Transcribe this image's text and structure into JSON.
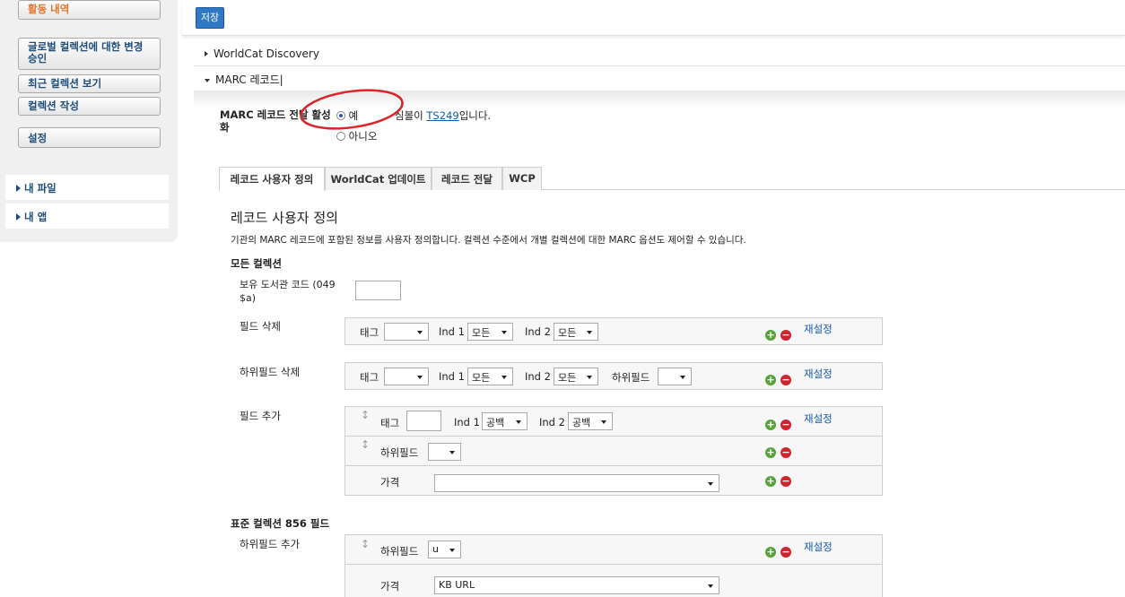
{
  "sidebar": {
    "activity": "활동 내역",
    "global_approve": "글로벌 컬렉션에 대한 변경 승인",
    "recent": "최근 컬렉션 보기",
    "create": "컬렉션 작성",
    "settings": "설정",
    "my_files": "내 파일",
    "my_apps": "내 앱"
  },
  "toolbar": {
    "save": "저장"
  },
  "sections": {
    "discovery": "WorldCat Discovery",
    "marc": "MARC 레코드|"
  },
  "marc_delivery": {
    "label": "MARC 레코드 전달 활성화",
    "yes": "예",
    "no": "아니오",
    "symbol_prefix": "심볼이 ",
    "symbol": "TS249",
    "symbol_suffix": "입니다."
  },
  "tabs": [
    "레코드 사용자 정의",
    "WorldCat 업데이트",
    "레코드 전달",
    "WCP"
  ],
  "content": {
    "heading": "레코드 사용자 정의",
    "description": "기관의 MARC 레코드에 포함된 정보를 사용자 정의합니다. 컬렉션 수준에서 개별 컬렉션에 대한 MARC 옵션도 제어할 수 있습니다.",
    "all_collections": "모든 컬렉션",
    "holding_code_label": "보유 도서관 코드 (049 $a)",
    "delete_field": "필드 삭제",
    "delete_subfield": "하위필드 삭제",
    "add_field": "필드 추가",
    "standard_856": "표준 컬렉션 856 필드",
    "add_subfield": "하위필드 추가"
  },
  "controls": {
    "tag": "태그",
    "ind1": "Ind 1",
    "ind2": "Ind 2",
    "subfield": "하위필드",
    "value": "가격",
    "all": "모든",
    "blank": "공백",
    "reset": "재설정",
    "u": "u",
    "kb_url": "KB URL"
  },
  "colors": {
    "accent": "#2f78c4",
    "plus": "#57a33a",
    "minus": "#d0242c",
    "annotation": "#d9262b"
  }
}
